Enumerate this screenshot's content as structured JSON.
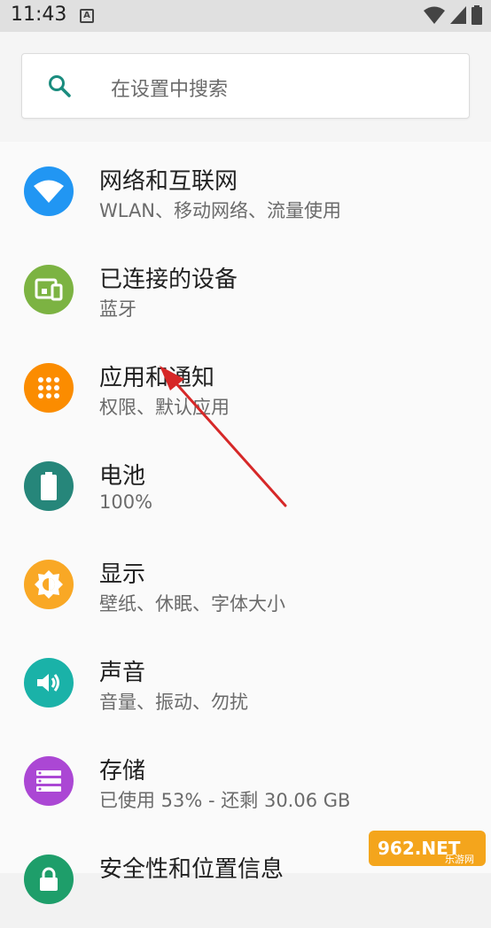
{
  "status_bar": {
    "time": "11:43",
    "notification_letter": "A"
  },
  "search": {
    "placeholder": "在设置中搜索"
  },
  "settings": [
    {
      "title": "网络和互联网",
      "subtitle": "WLAN、移动网络、流量使用",
      "icon": "wifi-icon",
      "color": "#2196f3"
    },
    {
      "title": "已连接的设备",
      "subtitle": "蓝牙",
      "icon": "devices-icon",
      "color": "#7cb342"
    },
    {
      "title": "应用和通知",
      "subtitle": "权限、默认应用",
      "icon": "apps-icon",
      "color": "#fb8c00"
    },
    {
      "title": "电池",
      "subtitle": "100%",
      "icon": "battery-icon",
      "color": "#26867a"
    },
    {
      "title": "显示",
      "subtitle": "壁纸、休眠、字体大小",
      "icon": "brightness-icon",
      "color": "#f9a825"
    },
    {
      "title": "声音",
      "subtitle": "音量、振动、勿扰",
      "icon": "volume-icon",
      "color": "#1ab2a8"
    },
    {
      "title": "存储",
      "subtitle": "已使用 53% - 还剩 30.06 GB",
      "icon": "storage-icon",
      "color": "#ab47d4"
    },
    {
      "title": "安全性和位置信息",
      "subtitle": "",
      "icon": "lock-icon",
      "color": "#1e9e6a"
    }
  ],
  "watermark": {
    "text": "962.NET",
    "subtext": "乐游网"
  }
}
